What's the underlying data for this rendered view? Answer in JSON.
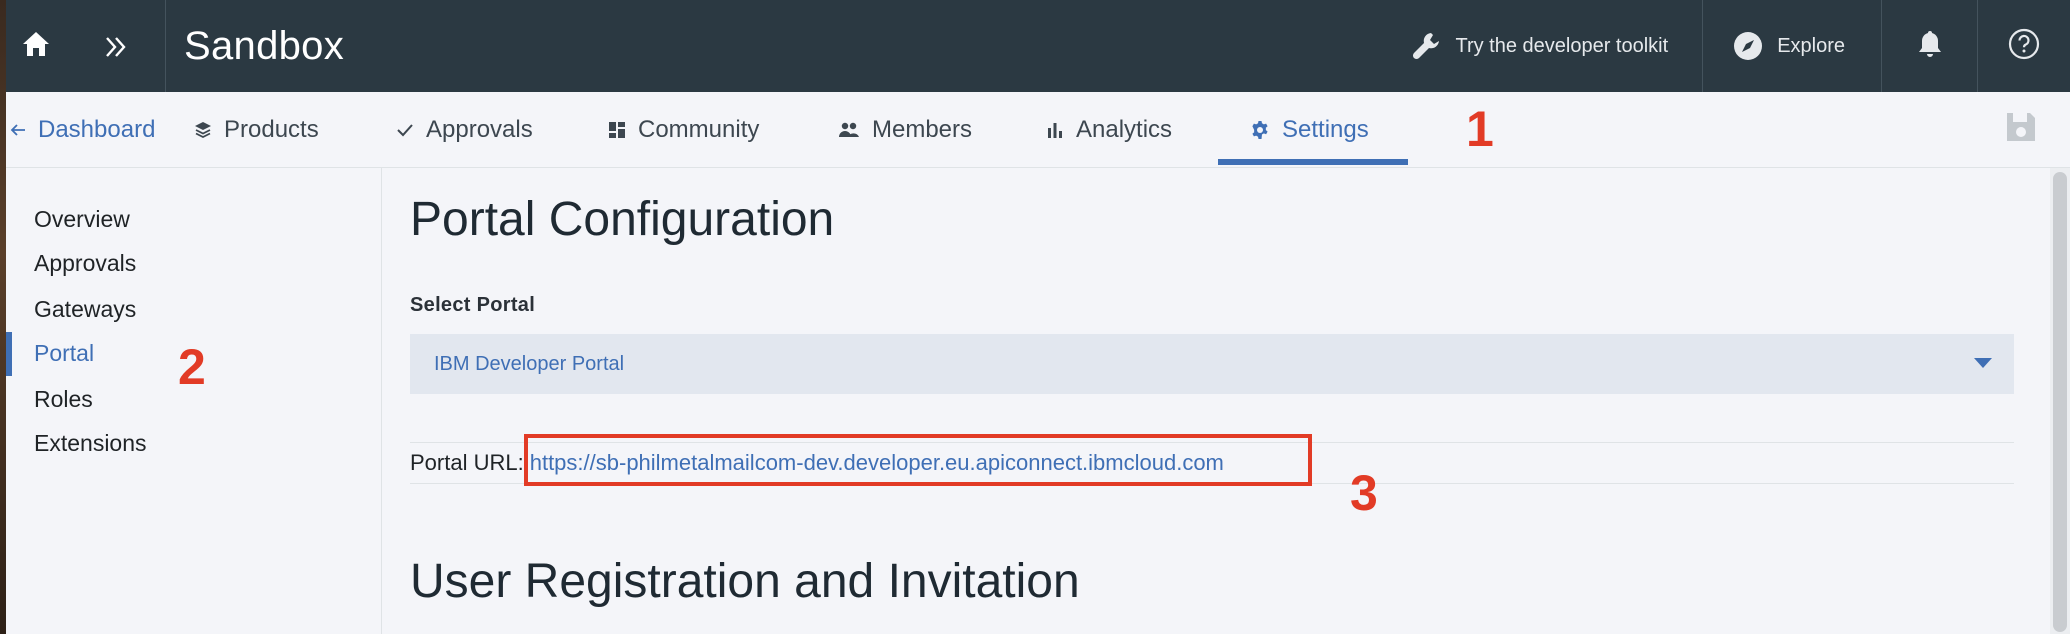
{
  "topbar": {
    "title": "Sandbox",
    "toolkit_label": "Try the developer toolkit",
    "explore_label": "Explore"
  },
  "tabs": {
    "back_label": "Dashboard",
    "items": [
      {
        "label": "Products",
        "icon": "layers-icon"
      },
      {
        "label": "Approvals",
        "icon": "check-icon"
      },
      {
        "label": "Community",
        "icon": "grid-icon"
      },
      {
        "label": "Members",
        "icon": "people-icon"
      },
      {
        "label": "Analytics",
        "icon": "bar-chart-icon"
      },
      {
        "label": "Settings",
        "icon": "gear-icon",
        "active": true
      }
    ]
  },
  "sidenav": {
    "items": [
      {
        "label": "Overview"
      },
      {
        "label": "Approvals"
      },
      {
        "label": "Gateways"
      },
      {
        "label": "Portal",
        "active": true
      },
      {
        "label": "Roles"
      },
      {
        "label": "Extensions"
      }
    ]
  },
  "main": {
    "heading": "Portal Configuration",
    "select_label": "Select Portal",
    "select_value": "IBM Developer Portal",
    "url_label": "Portal URL:",
    "url_value": "https://sb-philmetalmailcom-dev.developer.eu.apiconnect.ibmcloud.com",
    "heading2": "User Registration and Invitation"
  },
  "annotations": {
    "n1": "1",
    "n2": "2",
    "n3": "3"
  },
  "colors": {
    "topbar": "#2b3942",
    "accent": "#3f6fb5",
    "annotation": "#e23b26"
  }
}
